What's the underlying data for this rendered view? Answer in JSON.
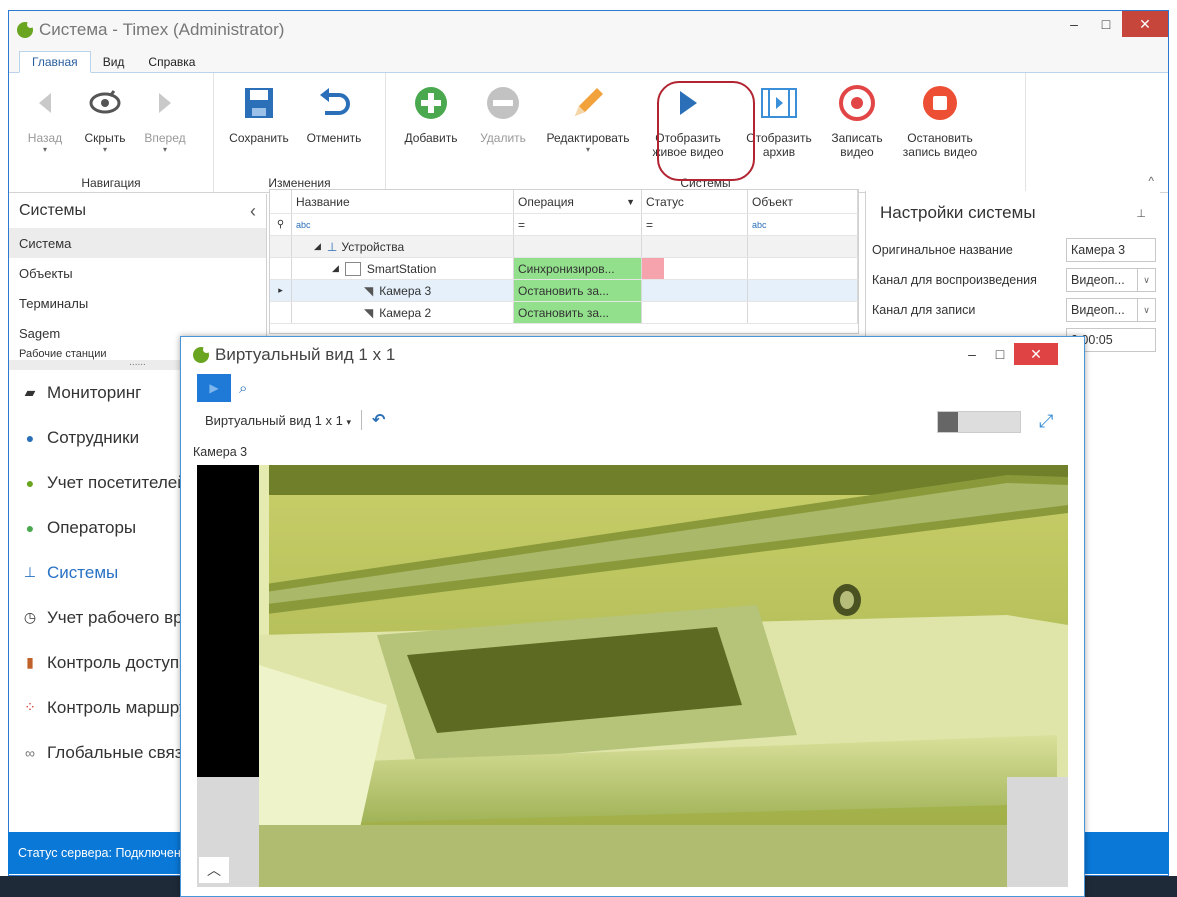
{
  "window": {
    "title": "Система - Timex (Administrator)",
    "controls": {
      "minimize": "–",
      "maximize": "□",
      "close": "✕"
    }
  },
  "menu_tabs": [
    "Главная",
    "Вид",
    "Справка"
  ],
  "ribbon": {
    "groups": [
      {
        "label": "Навигация",
        "buttons": [
          {
            "label": "Назад",
            "icon": "back-arrow-icon",
            "disabled": true
          },
          {
            "label": "Скрыть",
            "icon": "eye-hide-icon",
            "disabled": false
          },
          {
            "label": "Вперед",
            "icon": "forward-arrow-icon",
            "disabled": true
          }
        ]
      },
      {
        "label": "Изменения",
        "buttons": [
          {
            "label": "Сохранить",
            "icon": "save-icon"
          },
          {
            "label": "Отменить",
            "icon": "undo-icon"
          }
        ]
      },
      {
        "label": "Системы",
        "buttons": [
          {
            "label": "Добавить",
            "icon": "add-icon"
          },
          {
            "label": "Удалить",
            "icon": "remove-icon",
            "disabled": true
          },
          {
            "label": "Редактировать",
            "icon": "pencil-icon"
          },
          {
            "label": "Отобразить живое видео",
            "icon": "play-icon"
          },
          {
            "label": "Отобразить архив",
            "icon": "film-icon"
          },
          {
            "label": "Записать видео",
            "icon": "record-icon"
          },
          {
            "label": "Остановить запись видео",
            "icon": "stop-icon"
          }
        ]
      }
    ]
  },
  "left_panel": {
    "title": "Системы",
    "items": [
      "Система",
      "Объекты",
      "Терминалы",
      "Sagem",
      "Рабочие станции"
    ],
    "splitter": "......",
    "nav": [
      {
        "label": "Мониторинг",
        "icon": "monitor-icon"
      },
      {
        "label": "Сотрудники",
        "icon": "employees-icon"
      },
      {
        "label": "Учет посетителей",
        "icon": "visitors-icon"
      },
      {
        "label": "Операторы",
        "icon": "operators-icon"
      },
      {
        "label": "Системы",
        "icon": "systems-icon",
        "active": true
      },
      {
        "label": "Учет рабочего времени",
        "icon": "clock-icon"
      },
      {
        "label": "Контроль доступа",
        "icon": "door-icon"
      },
      {
        "label": "Контроль маршрутов",
        "icon": "route-icon"
      },
      {
        "label": "Глобальные связи",
        "icon": "link-icon"
      }
    ]
  },
  "grid": {
    "columns": [
      "Название",
      "Операция",
      "Статус",
      "Объект"
    ],
    "filter_row": [
      "=",
      "="
    ],
    "filter_icon_text": "abc",
    "rows": [
      {
        "name": "Устройства",
        "operation": "",
        "level": 0
      },
      {
        "name": "SmartStation",
        "operation": "Синхронизиров...",
        "level": 1
      },
      {
        "name": "Камера 3",
        "operation": "Остановить за...",
        "level": 2
      },
      {
        "name": "Камера 2",
        "operation": "Остановить за...",
        "level": 2
      }
    ]
  },
  "right_panel": {
    "title": "Настройки системы",
    "rows": [
      {
        "label": "Оригинальное название",
        "value": "Камера 3"
      },
      {
        "label": "Канал для воспроизведения",
        "value": "Видеоп..."
      },
      {
        "label": "Канал для записи",
        "value": "Видеоп..."
      },
      {
        "label": "",
        "value": "0:00:05"
      }
    ]
  },
  "status_bar": {
    "text": "Статус сервера: Подключено"
  },
  "video_window": {
    "title": "Виртуальный вид 1 x 1",
    "view_selector": "Виртуальный вид 1 x 1",
    "camera_label": "Камера 3"
  }
}
